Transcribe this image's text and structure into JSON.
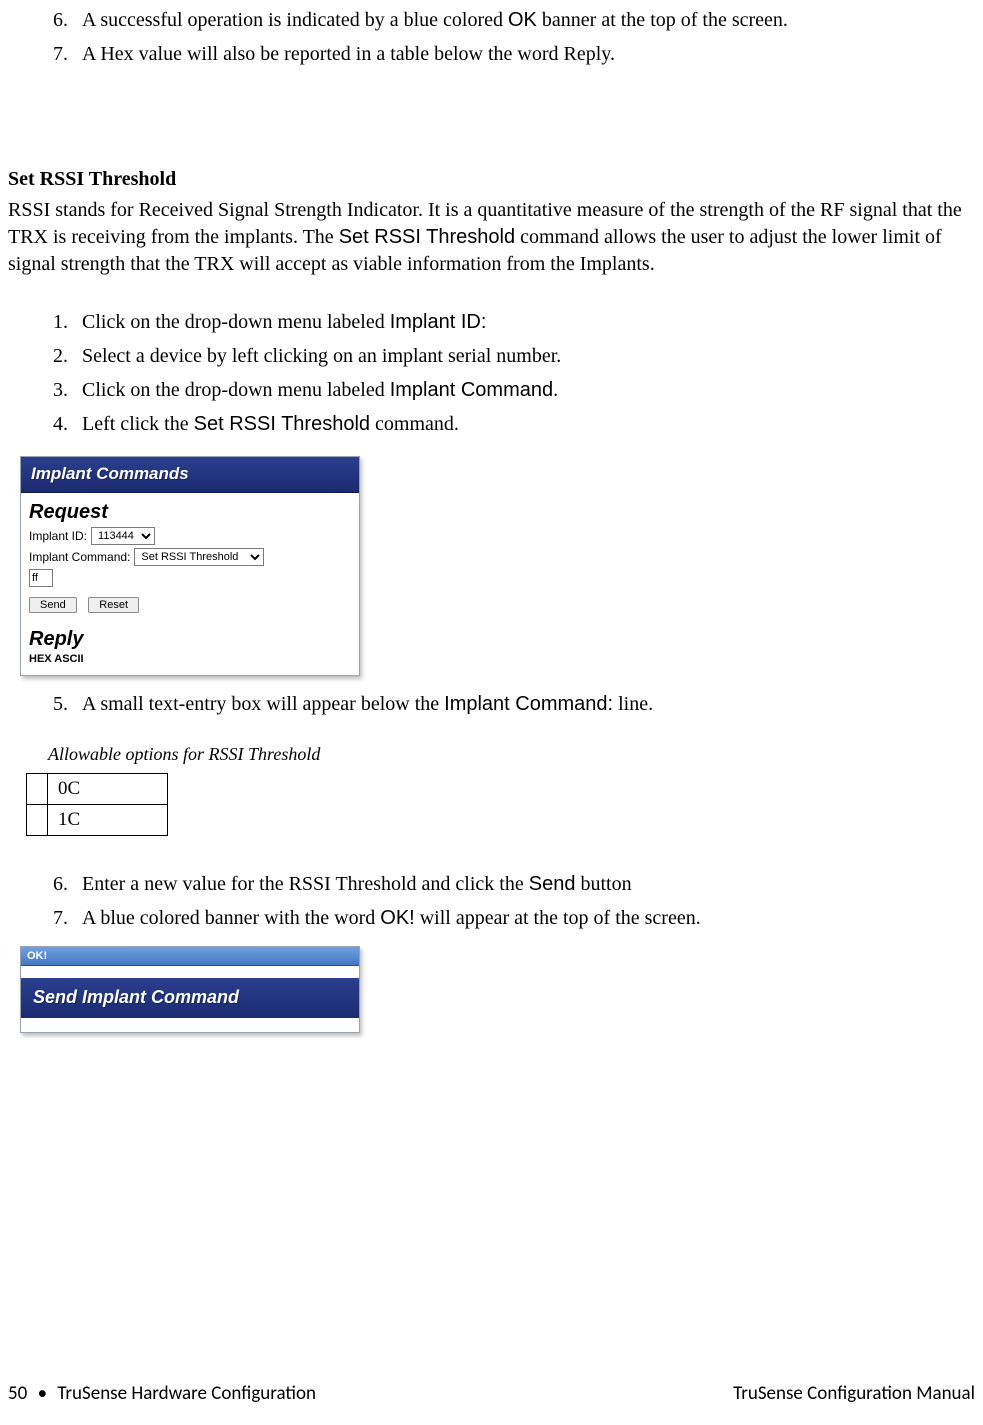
{
  "top_list": [
    {
      "num": "6.",
      "runs": [
        {
          "t": "A successful operation is indicated by a blue colored "
        },
        {
          "t": "OK",
          "cls": "sans"
        },
        {
          "t": " banner at the top of the screen."
        }
      ]
    },
    {
      "num": "7.",
      "runs": [
        {
          "t": "A Hex value will also be reported in a table below the word Reply."
        }
      ]
    }
  ],
  "section_heading": "Set RSSI Threshold",
  "intro_runs": [
    {
      "t": "RSSI stands for Received Signal Strength Indicator. It is a quantitative measure of the strength of the RF signal that the TRX is receiving from the implants.  The "
    },
    {
      "t": "Set RSSI Threshold",
      "cls": "sans"
    },
    {
      "t": " command allows the user to adjust the lower limit of signal strength that the TRX will accept as viable information from the Implants."
    }
  ],
  "steps_a": [
    {
      "num": "1.",
      "runs": [
        {
          "t": "Click on the drop-down menu labeled "
        },
        {
          "t": "Implant ID:",
          "cls": "sans"
        }
      ]
    },
    {
      "num": "2.",
      "runs": [
        {
          "t": "Select a device by left clicking on an implant serial number."
        }
      ]
    },
    {
      "num": "3.",
      "runs": [
        {
          "t": "Click on the drop-down menu labeled "
        },
        {
          "t": "Implant Command",
          "cls": "sans"
        },
        {
          "t": "."
        }
      ]
    },
    {
      "num": "4.",
      "runs": [
        {
          "t": "Left click the "
        },
        {
          "t": "Set RSSI Threshold",
          "cls": "sans"
        },
        {
          "t": " command."
        }
      ]
    }
  ],
  "shot1": {
    "title": "Implant Commands",
    "section_request": "Request",
    "label_implant_id": "Implant ID:",
    "value_implant_id": "113444",
    "label_implant_cmd": "Implant Command:",
    "value_implant_cmd": "Set RSSI Threshold",
    "value_param": "ff",
    "btn_send": "Send",
    "btn_reset": "Reset",
    "section_reply": "Reply",
    "reply_hdr": "HEX ASCII"
  },
  "step5": {
    "num": "5.",
    "runs": [
      {
        "t": "A small text-entry box will appear below the "
      },
      {
        "t": "Implant Command:",
        "cls": "sans"
      },
      {
        "t": " line."
      }
    ]
  },
  "options_caption": "Allowable options for RSSI Threshold",
  "options_rows": [
    "0C",
    "1C"
  ],
  "steps_b": [
    {
      "num": "6.",
      "runs": [
        {
          "t": "Enter a new value for the RSSI Threshold and click the "
        },
        {
          "t": "Send",
          "cls": "sans"
        },
        {
          "t": " button"
        }
      ]
    },
    {
      "num": "7.",
      "runs": [
        {
          "t": "A blue colored banner with the word "
        },
        {
          "t": "OK!",
          "cls": "sans"
        },
        {
          "t": " will appear at the top of the screen."
        }
      ]
    }
  ],
  "shot2": {
    "ok": "OK!",
    "title": "Send Implant Command"
  },
  "footer": {
    "page": "50",
    "left": "TruSense Hardware Configuration",
    "right": "TruSense Configuration Manual"
  }
}
